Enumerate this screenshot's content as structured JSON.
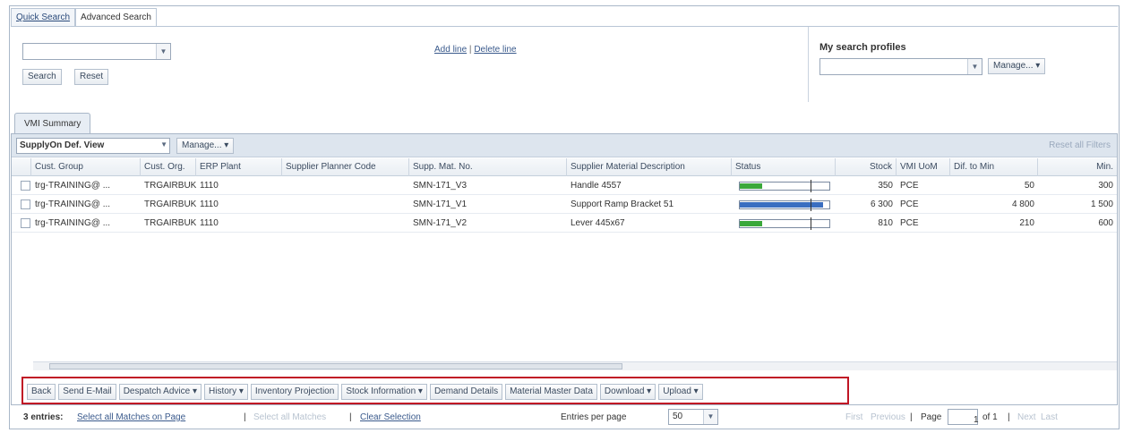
{
  "search_tabs": [
    {
      "label": "Quick Search",
      "active": false
    },
    {
      "label": "Advanced Search",
      "active": true
    }
  ],
  "search": {
    "field_value": "",
    "search_label": "Search",
    "reset_label": "Reset",
    "add_line": "Add line",
    "separator": "|",
    "delete_line": "Delete line"
  },
  "profiles": {
    "title": "My search profiles",
    "value": "",
    "manage_label": "Manage..."
  },
  "summary": {
    "tab_label": "VMI Summary",
    "view_value": "SupplyOn Def. View",
    "manage_label": "Manage...",
    "reset_filters": "Reset all Filters"
  },
  "columns": [
    "Cust. Group",
    "Cust. Org.",
    "ERP Plant",
    "Supplier Planner Code",
    "Supp. Mat. No.",
    "Supplier Material Description",
    "Status",
    "Stock",
    "VMI UoM",
    "Dif. to Min",
    "Min."
  ],
  "rows": [
    {
      "group": "trg-TRAINING@ ...",
      "org": "TRGAIRBUK",
      "plant": "1110",
      "planner": "",
      "mat": "SMN-171_V3",
      "desc": "Handle 4557",
      "status_fill": 0.25,
      "status_tick": 0.79,
      "status_color": "#3aa83a",
      "stock": "350",
      "uom": "PCE",
      "dif": "50",
      "min": "300"
    },
    {
      "group": "trg-TRAINING@ ...",
      "org": "TRGAIRBUK",
      "plant": "1110",
      "planner": "",
      "mat": "SMN-171_V1",
      "desc": "Support Ramp Bracket 51",
      "status_fill": 0.93,
      "status_tick": 0.79,
      "status_color": "#3a6ec0",
      "stock": "6 300",
      "uom": "PCE",
      "dif": "4 800",
      "min": "1 500"
    },
    {
      "group": "trg-TRAINING@ ...",
      "org": "TRGAIRBUK",
      "plant": "1110",
      "planner": "",
      "mat": "SMN-171_V2",
      "desc": "Lever 445x67",
      "status_fill": 0.25,
      "status_tick": 0.79,
      "status_color": "#3aa83a",
      "stock": "810",
      "uom": "PCE",
      "dif": "210",
      "min": "600"
    }
  ],
  "actions": [
    {
      "label": "Back",
      "dropdown": false
    },
    {
      "label": "Send E-Mail",
      "dropdown": false
    },
    {
      "label": "Despatch Advice ▾",
      "dropdown": true
    },
    {
      "label": "History ▾",
      "dropdown": true
    },
    {
      "label": "Inventory Projection",
      "dropdown": false
    },
    {
      "label": "Stock Information ▾",
      "dropdown": true
    },
    {
      "label": "Demand Details",
      "dropdown": false
    },
    {
      "label": "Material Master Data",
      "dropdown": false
    },
    {
      "label": "Download ▾",
      "dropdown": true
    },
    {
      "label": "Upload ▾",
      "dropdown": true
    }
  ],
  "footer": {
    "entries": "3 entries:",
    "select_page": "Select all Matches on Page",
    "sep": "|",
    "select_all": "Select all Matches",
    "clear": "Clear Selection",
    "per_page_label": "Entries per page",
    "per_page_value": "50",
    "first": "First",
    "previous": "Previous",
    "page_label": "Page",
    "page_value": "1",
    "of_total": "of 1",
    "next": "Next",
    "last": "Last"
  },
  "colors": {
    "accent_red": "#c01525",
    "header_bg": "#dde5ee",
    "link": "#3a5a8c"
  }
}
